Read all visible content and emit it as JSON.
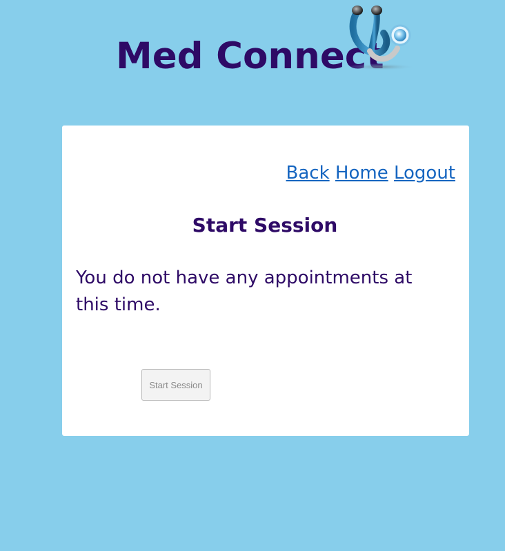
{
  "header": {
    "brand": "Med Connect",
    "logo_icon": "stethoscope-icon"
  },
  "nav": {
    "back": "Back",
    "home": "Home",
    "logout": "Logout"
  },
  "main": {
    "title": "Start Session",
    "message": "You do not have any appointments at this time.",
    "start_button": "Start Session",
    "start_button_disabled": true
  },
  "colors": {
    "background": "#87ceeb",
    "brand": "#2e0a66",
    "link": "#1565c0",
    "card": "#ffffff"
  }
}
